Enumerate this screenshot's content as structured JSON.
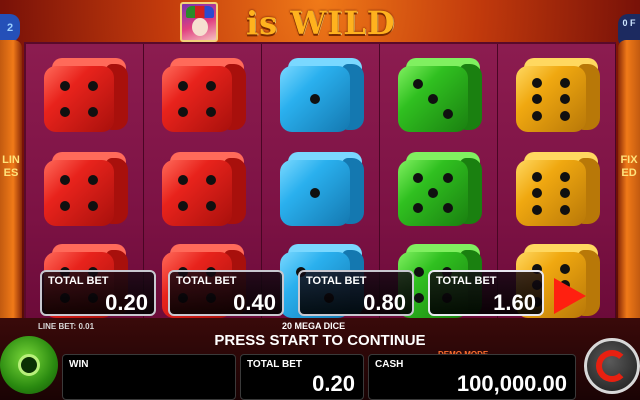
{
  "header": {
    "title": "is WILD"
  },
  "side": {
    "left_label": "LINES",
    "right_label": "FIXED",
    "left_corner": "2",
    "right_corner": "0 F"
  },
  "reels": [
    {
      "color": "red",
      "dice": [
        4,
        4,
        4
      ]
    },
    {
      "color": "red",
      "dice": [
        4,
        4,
        4
      ]
    },
    {
      "color": "blue",
      "dice": [
        1,
        1,
        2
      ]
    },
    {
      "color": "green",
      "dice": [
        3,
        5,
        4
      ]
    },
    {
      "color": "yellow",
      "dice": [
        6,
        6,
        6
      ]
    }
  ],
  "dice_colors": {
    "red": {
      "front": "#e8231c",
      "top": "#ff6a5a",
      "side": "#a8100c"
    },
    "blue": {
      "front": "#2ab0ee",
      "top": "#7ad8ff",
      "side": "#1478b0"
    },
    "green": {
      "front": "#30c020",
      "top": "#80f060",
      "side": "#1a8010"
    },
    "yellow": {
      "front": "#f0a810",
      "top": "#ffd860",
      "side": "#b87808"
    },
    "purple": {
      "front": "#c040d0",
      "top": "#e880f0",
      "side": "#802090"
    }
  },
  "bets": [
    {
      "label": "TOTAL BET",
      "value": "0.20"
    },
    {
      "label": "TOTAL BET",
      "value": "0.40"
    },
    {
      "label": "TOTAL BET",
      "value": "0.80"
    },
    {
      "label": "TOTAL BET",
      "value": "1.60"
    }
  ],
  "status": {
    "line_bet": "LINE BET: 0.01",
    "mega_dice": "20 MEGA DICE",
    "message": "PRESS START TO CONTINUE",
    "demo_mode": "DEMO MODE"
  },
  "panels": {
    "win_label": "WIN",
    "win_value": "",
    "total_bet_label": "TOTAL BET",
    "total_bet_value": "0.20",
    "cash_label": "CASH",
    "cash_value": "100,000.00"
  }
}
